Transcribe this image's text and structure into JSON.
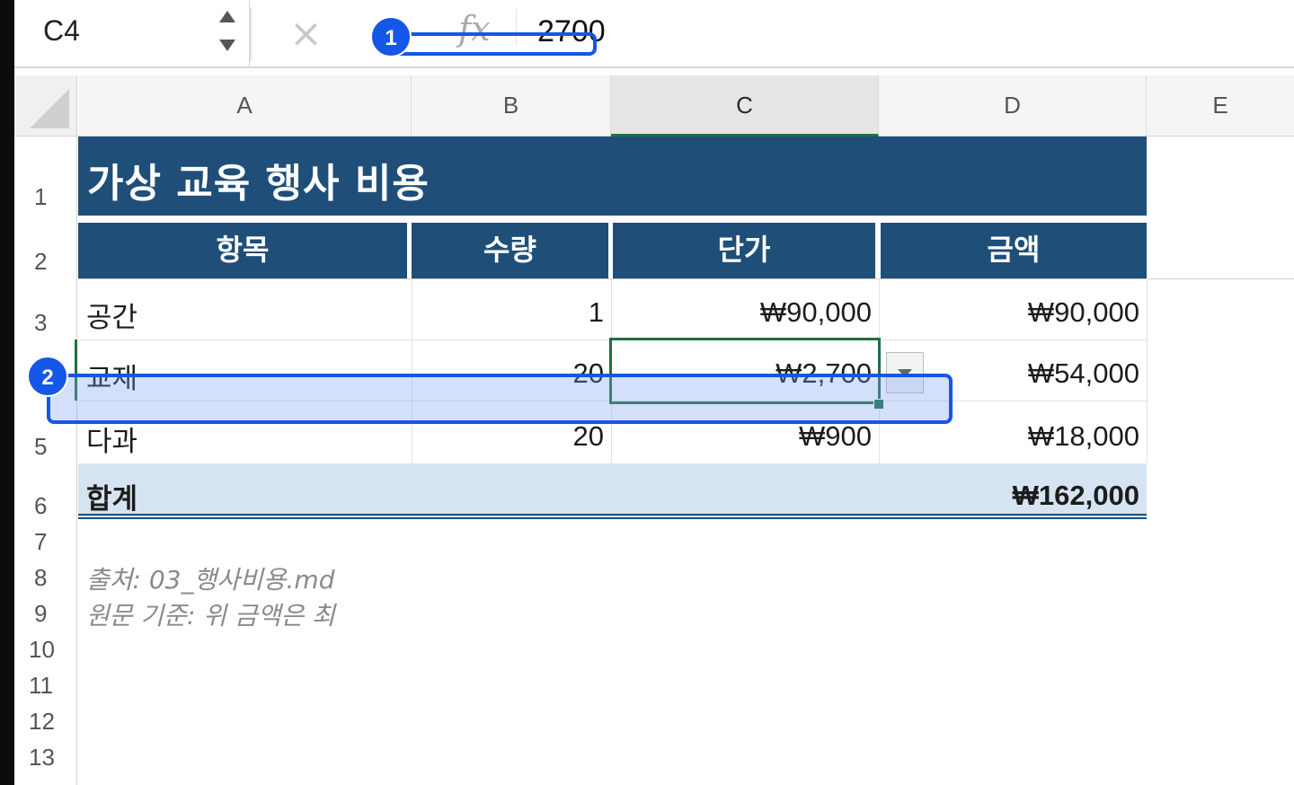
{
  "formula_bar": {
    "name_box": "C4",
    "cancel_glyph": "×",
    "fx_glyph": "fx",
    "value": "2700"
  },
  "columns": [
    "A",
    "B",
    "C",
    "D",
    "E"
  ],
  "rows": [
    "1",
    "2",
    "3",
    "4",
    "5",
    "6",
    "7",
    "8",
    "9",
    "10",
    "11",
    "12",
    "13"
  ],
  "sheet": {
    "title": "가상 교육 행사 비용",
    "headers": [
      "항목",
      "수량",
      "단가",
      "금액"
    ],
    "data_rows": [
      {
        "item": "공간",
        "qty": "1",
        "unit": "₩90,000",
        "amount": "₩90,000"
      },
      {
        "item": "교재",
        "qty": "20",
        "unit": "₩2,700",
        "amount": "₩54,000"
      },
      {
        "item": "다과",
        "qty": "20",
        "unit": "₩900",
        "amount": "₩18,000"
      }
    ],
    "total_label": "합계",
    "total_amount": "₩162,000",
    "note_source": "출처: 03_행사비용.md",
    "note_basis": "원문 기준: 위 금액은 최"
  },
  "annotations": [
    {
      "label": "1",
      "target": "formula-bar-value"
    },
    {
      "label": "2",
      "target": "row-4"
    }
  ],
  "colors": {
    "header_fill": "#1f4e79",
    "total_fill": "#d6e3f2",
    "selection": "#1e7145",
    "annotation": "#1557e6"
  }
}
